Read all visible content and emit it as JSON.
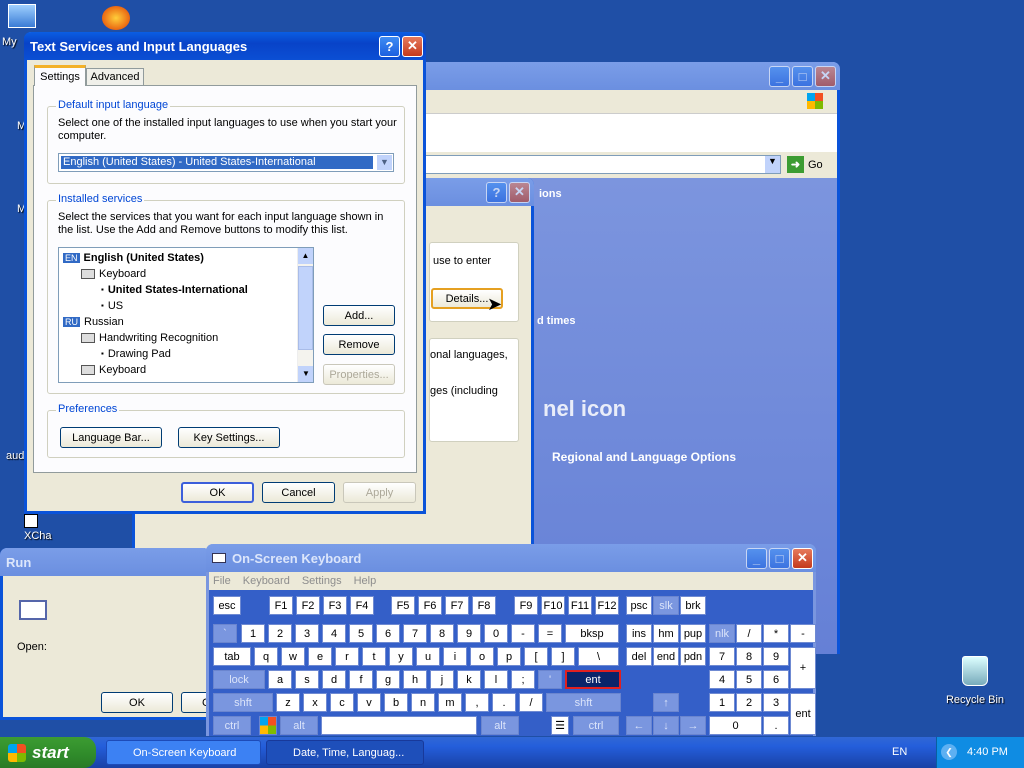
{
  "desktop": {
    "icons": [
      {
        "label": "My",
        "name": "my-documents-icon"
      },
      {
        "label": "aud",
        "name": "audacity-icon"
      },
      {
        "label": "XCha",
        "name": "xchat-icon"
      },
      {
        "label": "Recycle Bin",
        "name": "recycle-bin-icon"
      }
    ]
  },
  "bg_window": {
    "address_go": "Go",
    "sidebar_texts": [
      "ions",
      "d times",
      "nel icon",
      "Regional and Language Options"
    ]
  },
  "mid_dialog": {
    "text1": "use to enter",
    "details_button": "Details...",
    "text2": "onal languages,",
    "text3": "ges (including"
  },
  "run_dialog": {
    "title": "Run",
    "open_label": "Open:",
    "ok": "OK",
    "cancel": "C"
  },
  "tsil": {
    "title": "Text Services and Input Languages",
    "tabs": [
      "Settings",
      "Advanced"
    ],
    "default_group_title": "Default input language",
    "default_desc": "Select one of the installed input languages to use when you start your computer.",
    "default_select": "English (United States) - United States-International",
    "installed_group_title": "Installed services",
    "installed_desc": "Select the services that you want for each input language shown in the list. Use the Add and Remove buttons to modify this list.",
    "tree": [
      {
        "text": "English (United States)",
        "badge": "EN",
        "level": 0,
        "bold": true
      },
      {
        "text": "Keyboard",
        "level": 1,
        "icon": "keyboard"
      },
      {
        "text": "United States-International",
        "level": 2,
        "bold": true
      },
      {
        "text": "US",
        "level": 2
      },
      {
        "text": "Russian",
        "badge": "RU",
        "level": 0
      },
      {
        "text": "Handwriting Recognition",
        "level": 1,
        "icon": "pen"
      },
      {
        "text": "Drawing Pad",
        "level": 2
      },
      {
        "text": "Keyboard",
        "level": 1,
        "icon": "keyboard"
      }
    ],
    "add": "Add...",
    "remove": "Remove",
    "properties": "Properties...",
    "preferences_title": "Preferences",
    "language_bar": "Language Bar...",
    "key_settings": "Key Settings...",
    "ok": "OK",
    "cancel": "Cancel",
    "apply": "Apply"
  },
  "osk": {
    "title": "On-Screen Keyboard",
    "menu": [
      "File",
      "Keyboard",
      "Settings",
      "Help"
    ],
    "keys": [
      [
        "esc",
        "F1",
        "F2",
        "F3",
        "F4",
        "F5",
        "F6",
        "F7",
        "F8",
        "F9",
        "F10",
        "F11",
        "F12",
        "psc",
        "slk",
        "brk"
      ],
      [
        "`",
        "1",
        "2",
        "3",
        "4",
        "5",
        "6",
        "7",
        "8",
        "9",
        "0",
        "-",
        "=",
        "bksp",
        "ins",
        "hm",
        "pup",
        "nlk",
        "/",
        "*",
        "-"
      ],
      [
        "tab",
        "q",
        "w",
        "e",
        "r",
        "t",
        "y",
        "u",
        "i",
        "o",
        "p",
        "[",
        "]",
        "\\",
        "del",
        "end",
        "pdn",
        "7",
        "8",
        "9",
        "+"
      ],
      [
        "lock",
        "a",
        "s",
        "d",
        "f",
        "g",
        "h",
        "j",
        "k",
        "l",
        ";",
        "'",
        "ent",
        "4",
        "5",
        "6"
      ],
      [
        "shft",
        "z",
        "x",
        "c",
        "v",
        "b",
        "n",
        "m",
        ",",
        ".",
        "/",
        "shft",
        "↑",
        "1",
        "2",
        "3",
        "ent"
      ],
      [
        "ctrl",
        "alt",
        "alt",
        "ctrl",
        "←",
        "↓",
        "→",
        "0",
        "."
      ]
    ]
  },
  "taskbar": {
    "start": "start",
    "tasks": [
      "On-Screen Keyboard",
      "Date, Time, Languag..."
    ],
    "lang": "EN",
    "clock": "4:40 PM"
  }
}
